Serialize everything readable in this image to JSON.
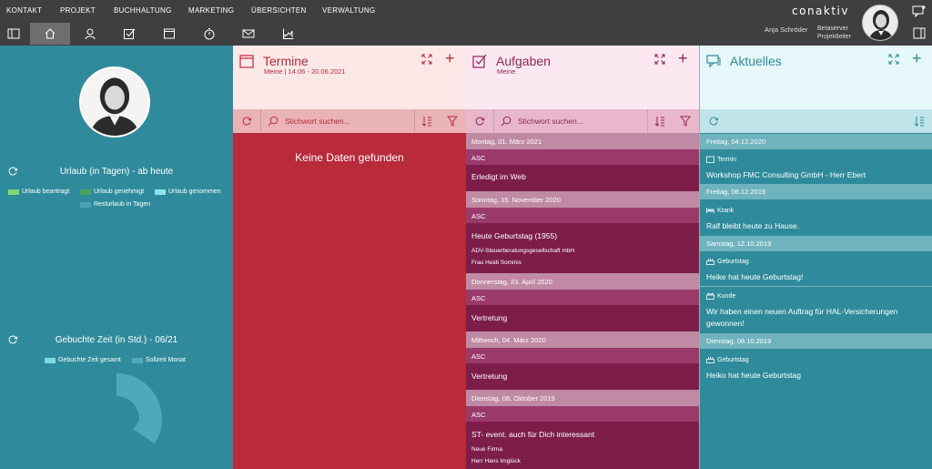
{
  "menu": [
    "KONTAKT",
    "PROJEKT",
    "BUCHHALTUNG",
    "MARKETING",
    "ÜBERSICHTEN",
    "VERWALTUNG"
  ],
  "brand": "conaktiv",
  "user": {
    "name": "Anja Schröder",
    "server": "Betaserver",
    "role": "Projektleiter"
  },
  "left": {
    "urlaub_title": "Urlaub (in Tagen) - ab heute",
    "urlaub_legend": [
      "Urlaub beantragt",
      "Urlaub genehmigt",
      "Urlaub genommen",
      "Resturlaub in Tagen"
    ],
    "gebucht_title": "Gebuchte Zeit (in Std.) - 06/21",
    "gebucht_legend": [
      "Gebuchte Zeit gesamt",
      "Sollzeit Monat"
    ],
    "colors": {
      "beantragt": "#7ddc6e",
      "genehmigt": "#4fa05e",
      "genommen": "#8fe3ee",
      "rest": "#4aa3b3",
      "gesamt": "#7fd8e6",
      "soll": "#4fa9b8"
    }
  },
  "termine": {
    "title": "Termine",
    "subtitle": "Meine | 14.06 - 20.06.2021",
    "search_placeholder": "Stichwort suchen...",
    "empty": "Keine Daten gefunden"
  },
  "aufgaben": {
    "title": "Aufgaben",
    "subtitle": "Meine",
    "search_placeholder": "Stichwort suchen...",
    "groups": [
      {
        "date": "Montag, 01. März 2021",
        "tag": "ASC",
        "title": "Erledigt im Web",
        "company": "",
        "person": ""
      },
      {
        "date": "Sonntag, 15. November 2020",
        "tag": "ASC",
        "title": "Heute Geburtstag (1955)",
        "company": "ADV-Steuerberatungsgesellschaft mbH",
        "person": "Frau Heidi Sominis"
      },
      {
        "date": "Donnerstag, 23. April 2020",
        "tag": "ASC",
        "title": "Vertretung",
        "company": "",
        "person": ""
      },
      {
        "date": "Mittwoch, 04. März 2020",
        "tag": "ASC",
        "title": "Vertretung",
        "company": "",
        "person": ""
      },
      {
        "date": "Dienstag, 08. Oktober 2019",
        "tag": "ASC",
        "title": "ST- event. auch für Dich interessant",
        "company": "Neue Firma",
        "person": "Herr Hans Imglück"
      }
    ]
  },
  "aktuelles": {
    "title": "Aktuelles",
    "items": [
      {
        "date": "Freitag, 04.12.2020",
        "cat": "Termin",
        "icon": "calendar-icon",
        "msg": "Workshop FMC Consulting GmbH - Herr Ebert"
      },
      {
        "date": "Freitag, 06.12.2019",
        "cat": "Krank",
        "icon": "bed-icon",
        "msg": "Ralf bleibt heute zu Hause."
      },
      {
        "date": "Samstag, 12.10.2019",
        "cat": "Geburtstag",
        "icon": "cake-icon",
        "msg": "Heike hat heute Geburtstag!"
      },
      {
        "date": "",
        "cat": "Kunde",
        "icon": "customer-icon",
        "msg": "Wir haben einen neuen Auftrag für HAL-Versicherungen gewonnen!"
      },
      {
        "date": "Dienstag, 08.10.2019",
        "cat": "Geburtstag",
        "icon": "cake-icon",
        "msg": "Heiko hat heute Geburtstag"
      }
    ]
  }
}
